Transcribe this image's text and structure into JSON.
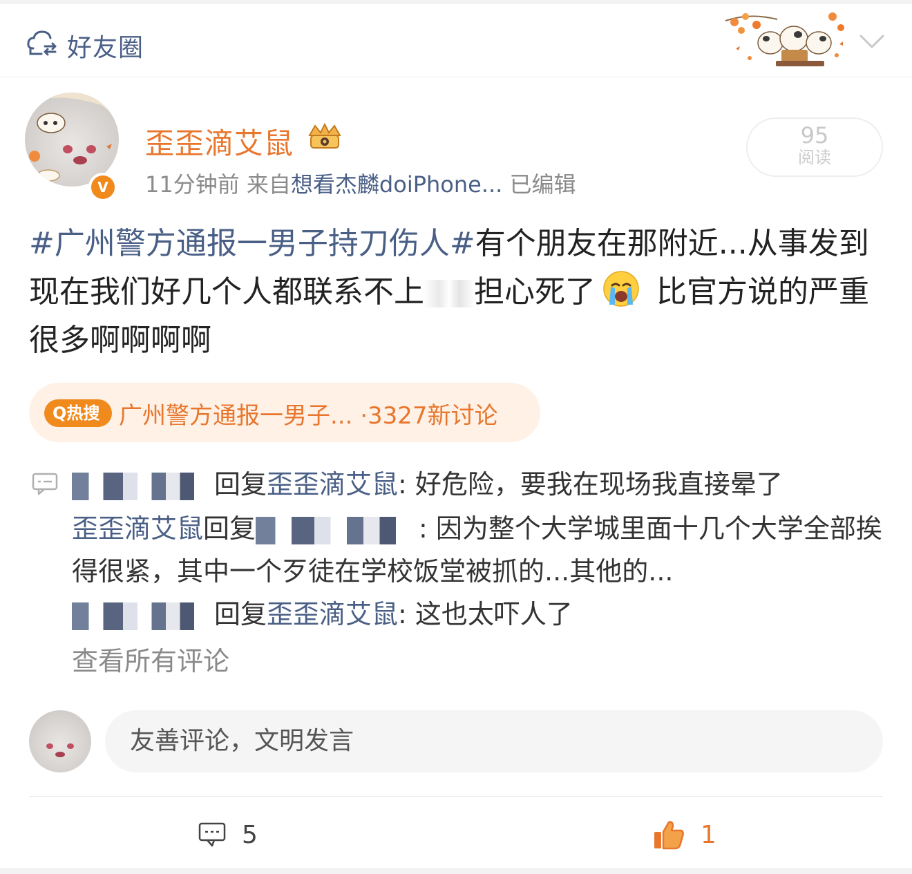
{
  "header": {
    "title": "好友圈",
    "icon": "cloud-friends-icon",
    "chevron_icon": "chevron-down-icon"
  },
  "post": {
    "author": "歪歪滴艾鼠",
    "verified_icon": "verified-v-icon",
    "vip_icon": "crown-badge-icon",
    "time": "11分钟前",
    "from_label": "来自",
    "source": "想看杰麟doiPhone...",
    "edited": "已编辑",
    "reads_count": "95",
    "reads_label": "阅读",
    "hashtag": "#广州警方通报一男子持刀伤人#",
    "text_part1": "有个朋友在那附近...从事发到现在我们好几个人都联系不上",
    "text_part2": "担心死了",
    "emoji": "crying-face-emoji",
    "text_part3": " 比官方说的严重很多啊啊啊啊"
  },
  "hot_search": {
    "badge": "热搜",
    "text": "广州警方通报一男子... ·3327新讨论"
  },
  "comments": [
    {
      "reply_word": "回复",
      "target": "歪歪滴艾鼠",
      "text": ": 好危险，要我在现场我直接晕了"
    },
    {
      "author": "歪歪滴艾鼠",
      "reply_word": "回复",
      "text": ": 因为整个大学城里面十几个大学全部挨得很紧，其中一个歹徒在学校饭堂被抓的...其他的..."
    },
    {
      "reply_word": "回复",
      "target": "歪歪滴艾鼠",
      "text": ": 这也太吓人了"
    }
  ],
  "view_all": "查看所有评论",
  "comment_input": {
    "placeholder": "友善评论，文明发言"
  },
  "actions": {
    "comment_count": "5",
    "like_count": "1"
  },
  "colors": {
    "accent_orange": "#e8762d",
    "link_blue": "#4a5f86",
    "hot_bg": "#fff1e6"
  }
}
